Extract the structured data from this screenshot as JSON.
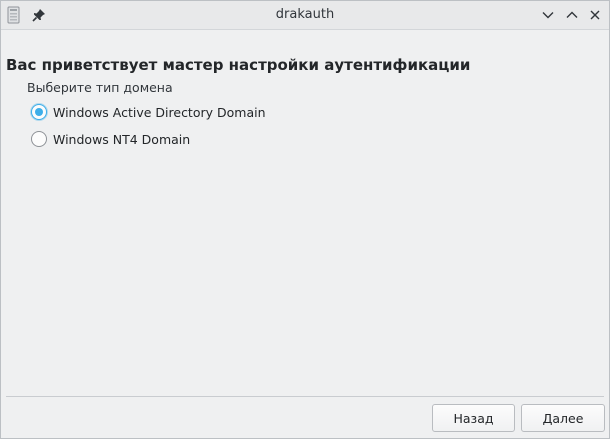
{
  "window": {
    "title": "drakauth"
  },
  "content": {
    "heading": "Вас приветствует мастер настройки аутентификации",
    "group_label": "Выберите тип домена",
    "options": [
      {
        "label": "Windows Active Directory Domain",
        "selected": true
      },
      {
        "label": "Windows NT4 Domain",
        "selected": false
      }
    ]
  },
  "footer": {
    "back_label": "Назад",
    "next_label": "Далее"
  },
  "colors": {
    "accent": "#3daee9",
    "background": "#eff0f1",
    "text": "#232629"
  },
  "icons": {
    "app": "app-icon",
    "pin": "pin-icon",
    "minimize": "chevron-down-icon",
    "maximize": "chevron-up-icon",
    "close": "close-icon"
  }
}
